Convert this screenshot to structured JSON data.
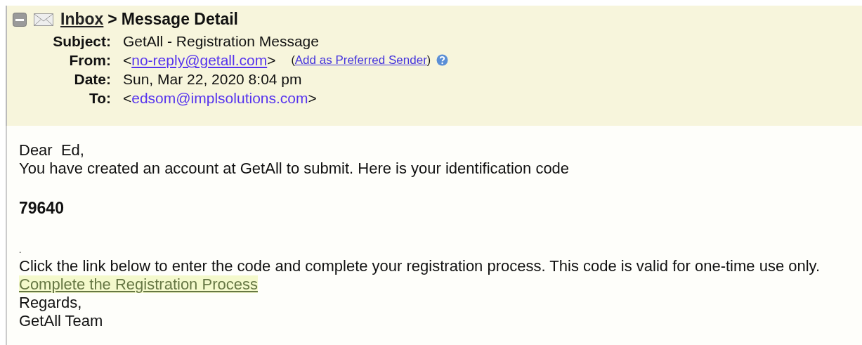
{
  "breadcrumb": {
    "link": "Inbox",
    "separator": ">",
    "current": "Message Detail"
  },
  "fields": [
    {
      "label": "Subject:",
      "parts": [
        {
          "kind": "text",
          "text": "GetAll - Registration Message"
        }
      ]
    },
    {
      "label": "From:",
      "help": true,
      "parts": [
        {
          "kind": "text",
          "text": "<"
        },
        {
          "kind": "link",
          "text": "no-reply@getall.com"
        },
        {
          "kind": "text",
          "text": ">"
        },
        {
          "kind": "smalltext",
          "text": "("
        },
        {
          "kind": "smalllink",
          "text": "Add as Preferred Sender"
        },
        {
          "kind": "smalltext",
          "text": ")"
        }
      ]
    },
    {
      "label": "Date:",
      "parts": [
        {
          "kind": "text",
          "text": "Sun, Mar 22, 2020 8:04 pm"
        }
      ]
    },
    {
      "label": "To:",
      "parts": [
        {
          "kind": "text",
          "text": "<"
        },
        {
          "kind": "address",
          "text": "edsom@implsolutions.com"
        },
        {
          "kind": "text",
          "text": ">"
        }
      ]
    }
  ],
  "body": [
    {
      "kind": "text",
      "text": "Dear  Ed,"
    },
    {
      "kind": "text",
      "text": "You have created an account at GetAll to submit. Here is your identification code"
    },
    {
      "kind": "code",
      "text": "79640"
    },
    {
      "kind": "dot",
      "text": "."
    },
    {
      "kind": "text",
      "text": "Click the link below to enter the code and complete your registration process. This code is valid for one-time use only."
    },
    {
      "kind": "link",
      "text": "Complete the Registration Process"
    },
    {
      "kind": "text",
      "text": "Regards,"
    },
    {
      "kind": "text",
      "text": "GetAll Team"
    }
  ]
}
